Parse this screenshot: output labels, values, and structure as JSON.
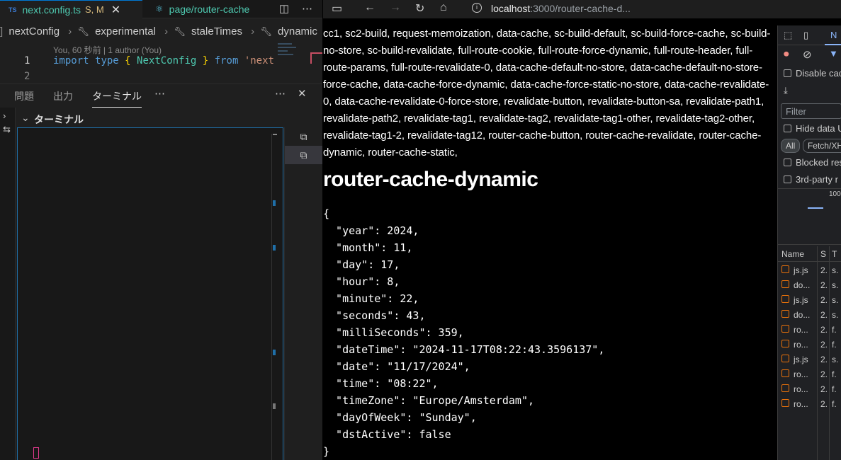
{
  "vscode": {
    "tabs": [
      {
        "badge": "TS",
        "name": "next.config.ts",
        "status": "S, M",
        "close": "✕"
      },
      {
        "name": "page/router-cache"
      }
    ],
    "breadcrumb": [
      "nextConfig",
      "experimental",
      "staleTimes",
      "dynamic"
    ],
    "blame": "You, 60 秒前 | 1 author (You)",
    "code": {
      "line1_num": "1",
      "line2_num": "2",
      "import": "import",
      "type": "type",
      "open_brace": "{",
      "name": "NextConfig",
      "close_brace": "}",
      "from": "from",
      "module": "'next"
    },
    "panel_tabs": [
      "問題",
      "出力",
      "ターミナル"
    ],
    "panel_more": "⋯",
    "panel_close": "✕",
    "terminal_header": "ターミナル"
  },
  "browser": {
    "address_host": "localhost",
    "address_path": ":3000/router-cache-d...",
    "links_text": "cc1, sc2-build, request-memoization, data-cache, sc-build-default, sc-build-force-cache, sc-build-no-store, sc-build-revalidate, full-route-cookie, full-route-force-dynamic, full-route-header, full-route-params, full-route-revalidate-0, data-cache-default-no-store, data-cache-default-no-store-force-cache, data-cache-force-dynamic, data-cache-force-static-no-store, data-cache-revalidate-0, data-cache-revalidate-0-force-store, revalidate-button, revalidate-button-sa, revalidate-path1, revalidate-path2, revalidate-tag1, revalidate-tag2, revalidate-tag1-other, revalidate-tag2-other, revalidate-tag1-2, revalidate-tag12, router-cache-button, router-cache-revalidate, router-cache-dynamic, router-cache-static,",
    "heading": "router-cache-dynamic",
    "json_text": "{\n  \"year\": 2024,\n  \"month\": 11,\n  \"day\": 17,\n  \"hour\": 8,\n  \"minute\": 22,\n  \"seconds\": 43,\n  \"milliSeconds\": 359,\n  \"dateTime\": \"2024-11-17T08:22:43.3596137\",\n  \"date\": \"11/17/2024\",\n  \"time\": \"08:22\",\n  \"timeZone\": \"Europe/Amsterdam\",\n  \"dayOfWeek\": \"Sunday\",\n  \"dstActive\": false\n}"
  },
  "devtools": {
    "tab_label": "N",
    "disable_cache": "Disable cac",
    "filter_placeholder": "Filter",
    "hide_data": "Hide data U",
    "filter_all": "All",
    "filter_fetch": "Fetch/XH",
    "blocked": "Blocked res",
    "third_party": "3rd-party r",
    "timeline_tick": "100",
    "columns": {
      "name": "Name",
      "status": "S",
      "type": "T"
    },
    "rows": [
      {
        "name": "js.js",
        "status": "2.",
        "type": "s."
      },
      {
        "name": "do...",
        "status": "2.",
        "type": "s."
      },
      {
        "name": "js.js",
        "status": "2.",
        "type": "s."
      },
      {
        "name": "do...",
        "status": "2.",
        "type": "s."
      },
      {
        "name": "ro...",
        "status": "2.",
        "type": "f."
      },
      {
        "name": "ro...",
        "status": "2.",
        "type": "f."
      },
      {
        "name": "js.js",
        "status": "2.",
        "type": "s."
      },
      {
        "name": "ro...",
        "status": "2.",
        "type": "f."
      },
      {
        "name": "ro...",
        "status": "2.",
        "type": "f."
      },
      {
        "name": "ro...",
        "status": "2.",
        "type": "f."
      }
    ]
  }
}
